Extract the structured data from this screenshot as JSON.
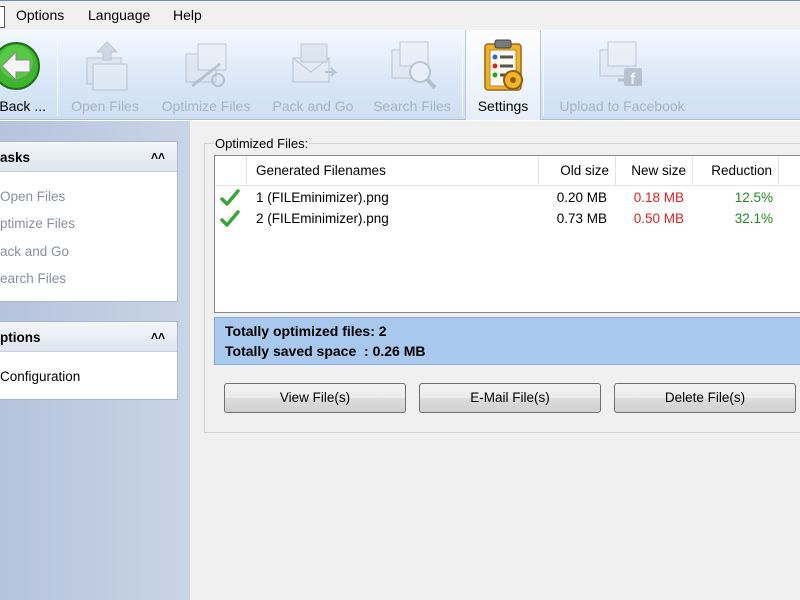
{
  "menubar": {
    "items": [
      "Options",
      "Language",
      "Help"
    ]
  },
  "toolbar": {
    "buttons": [
      {
        "label": "Back ...",
        "icon": "back-arrow-icon",
        "enabled": true
      },
      {
        "label": "Open Files",
        "icon": "open-files-icon",
        "enabled": false
      },
      {
        "label": "Optimize Files",
        "icon": "optimize-files-icon",
        "enabled": false
      },
      {
        "label": "Pack and Go",
        "icon": "pack-and-go-icon",
        "enabled": false
      },
      {
        "label": "Search Files",
        "icon": "search-files-icon",
        "enabled": false
      },
      {
        "label": "Settings",
        "icon": "settings-clipboard-icon",
        "enabled": true
      },
      {
        "label": "Upload to Facebook",
        "icon": "facebook-upload-icon",
        "enabled": false
      }
    ]
  },
  "sidebar": {
    "tasks": {
      "title": "asks",
      "items": [
        "Open Files",
        "ptimize Files",
        "ack and Go",
        "earch Files"
      ]
    },
    "options": {
      "title": "ptions",
      "items": [
        "Configuration"
      ]
    }
  },
  "main": {
    "group_title": "Optimized Files:",
    "columns": [
      "Generated Filenames",
      "Old size",
      "New size",
      "Reduction"
    ],
    "rows": [
      {
        "name": "1 (FILEminimizer).png",
        "old": "0.20 MB",
        "new": "0.18 MB",
        "reduction": "12.5%"
      },
      {
        "name": "2 (FILEminimizer).png",
        "old": "0.73 MB",
        "new": "0.50 MB",
        "reduction": "32.1%"
      }
    ],
    "summary": {
      "line1": "Totally optimized files: 2",
      "line2": "Totally saved space  : 0.26 MB"
    },
    "buttons": {
      "view": "View File(s)",
      "email": "E-Mail File(s)",
      "delete": "Delete File(s)"
    }
  },
  "colors": {
    "new_size": "#e02020",
    "reduction": "#1f8a1f",
    "summary_bg": "#a8c8ee",
    "check": "#3aa33a"
  }
}
